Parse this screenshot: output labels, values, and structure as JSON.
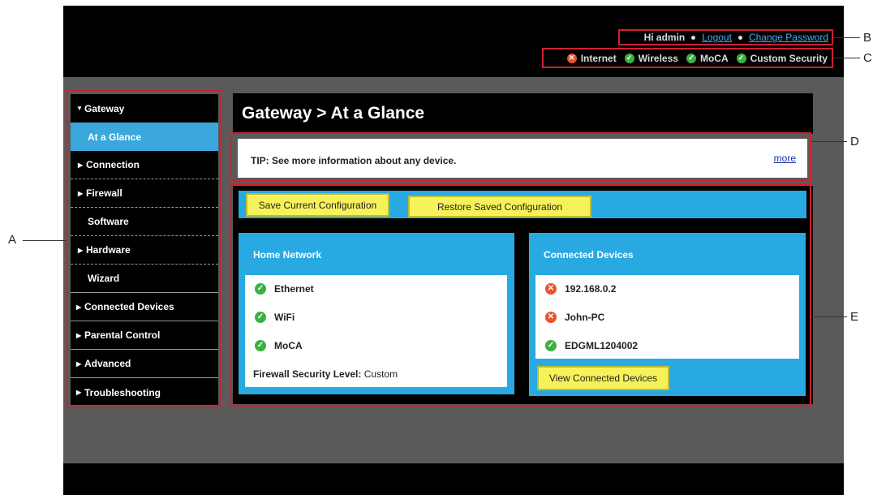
{
  "header": {
    "greeting": "Hi admin",
    "logout_label": "Logout",
    "change_password_label": "Change Password"
  },
  "status": [
    {
      "label": "Internet",
      "state": "error"
    },
    {
      "label": "Wireless",
      "state": "ok"
    },
    {
      "label": "MoCA",
      "state": "ok"
    },
    {
      "label": "Custom Security",
      "state": "ok"
    }
  ],
  "sidebar": {
    "items": [
      {
        "label": "Gateway",
        "caret": "▼"
      },
      {
        "label": "At a Glance"
      },
      {
        "label": "Connection",
        "caret": "▶"
      },
      {
        "label": "Firewall",
        "caret": "▶"
      },
      {
        "label": "Software"
      },
      {
        "label": "Hardware",
        "caret": "▶"
      },
      {
        "label": "Wizard"
      },
      {
        "label": "Connected Devices",
        "caret": "▶"
      },
      {
        "label": "Parental Control",
        "caret": "▶"
      },
      {
        "label": "Advanced",
        "caret": "▶"
      },
      {
        "label": "Troubleshooting",
        "caret": "▶"
      }
    ]
  },
  "main": {
    "title": "Gateway > At a Glance",
    "tip_text": "TIP: See more information about any device.",
    "tip_more_label": "more",
    "save_config_label": "Save Current Configuration",
    "restore_config_label": "Restore Saved Configuration",
    "home_network": {
      "title": "Home Network",
      "items": [
        {
          "label": "Ethernet",
          "state": "ok"
        },
        {
          "label": "WiFi",
          "state": "ok"
        },
        {
          "label": "MoCA",
          "state": "ok"
        }
      ],
      "firewall_label": "Firewall Security Level:",
      "firewall_value": "Custom"
    },
    "connected_devices": {
      "title": "Connected Devices",
      "items": [
        {
          "label": "192.168.0.2",
          "state": "error"
        },
        {
          "label": "John-PC",
          "state": "error"
        },
        {
          "label": "EDGML1204002",
          "state": "ok"
        }
      ],
      "view_button_label": "View Connected Devices"
    }
  },
  "callouts": {
    "a": "A",
    "b": "B",
    "c": "C",
    "d": "D",
    "e": "E"
  },
  "colors": {
    "accent_blue": "#29a9e1",
    "active_nav": "#3aa8dd",
    "button_yellow": "#f6f25a",
    "ok_green": "#3cb043",
    "error_red": "#e8542f",
    "callout_red": "#d0202e"
  },
  "icons": {
    "ok": "check-circle-icon",
    "error": "x-circle-icon"
  }
}
